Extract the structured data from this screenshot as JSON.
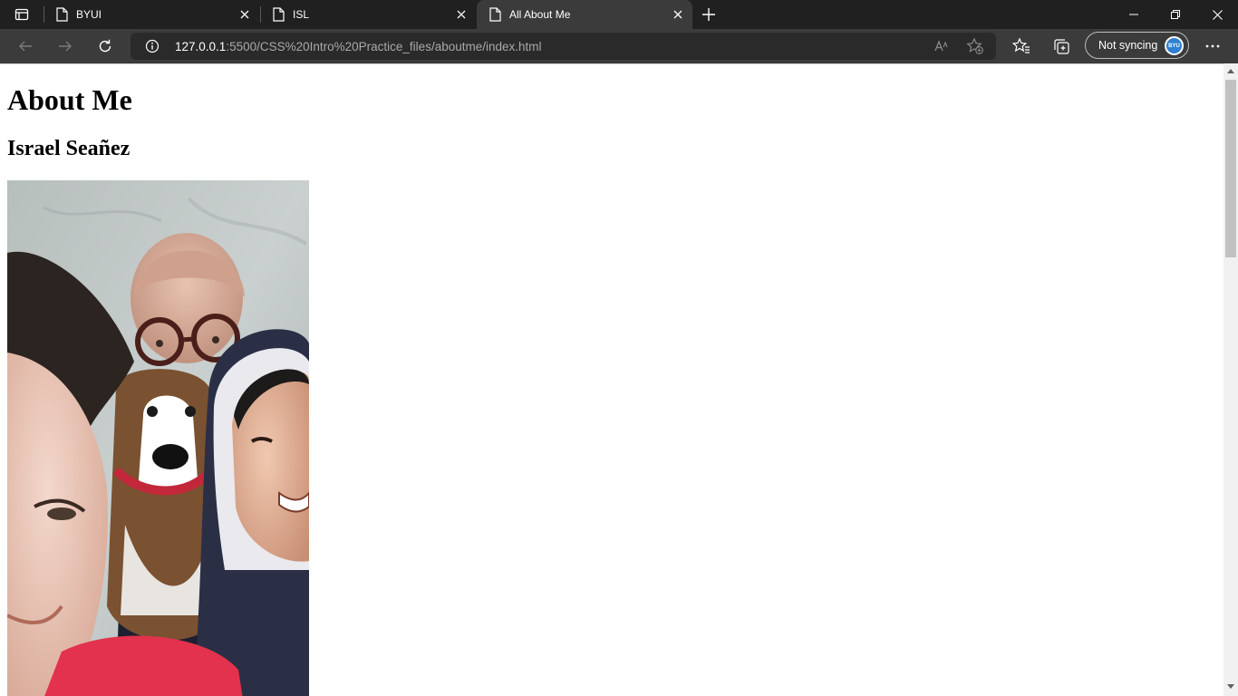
{
  "browser": {
    "tabs": [
      {
        "title": "BYUI",
        "active": false
      },
      {
        "title": "ISL",
        "active": false
      },
      {
        "title": "All About Me",
        "active": true
      }
    ],
    "address": {
      "host": "127.0.0.1",
      "path": ":5500/CSS%20Intro%20Practice_files/aboutme/index.html"
    },
    "profile": {
      "label": "Not syncing",
      "avatar_text": "BYU"
    },
    "icons": {
      "tab_actions": "tab-actions-icon",
      "page_favicon": "page-icon",
      "close": "close-icon",
      "new_tab": "plus-icon",
      "minimize": "minimize-icon",
      "restore": "restore-icon",
      "window_close": "close-icon",
      "back": "back-arrow-icon",
      "forward": "forward-arrow-icon",
      "refresh": "refresh-icon",
      "site_info": "info-icon",
      "read_aloud": "read-aloud-icon",
      "add_favorite": "add-favorite-icon",
      "favorites": "favorites-icon",
      "collections": "collections-icon",
      "more": "more-icon"
    }
  },
  "page": {
    "heading": "About Me",
    "name": "Israel Seañez"
  },
  "colors": {
    "tabstrip": "#202020",
    "toolbar": "#3b3b3b",
    "omnibox": "#2a2a2a",
    "page_bg": "#ffffff",
    "avatar": "#2f80d0"
  }
}
